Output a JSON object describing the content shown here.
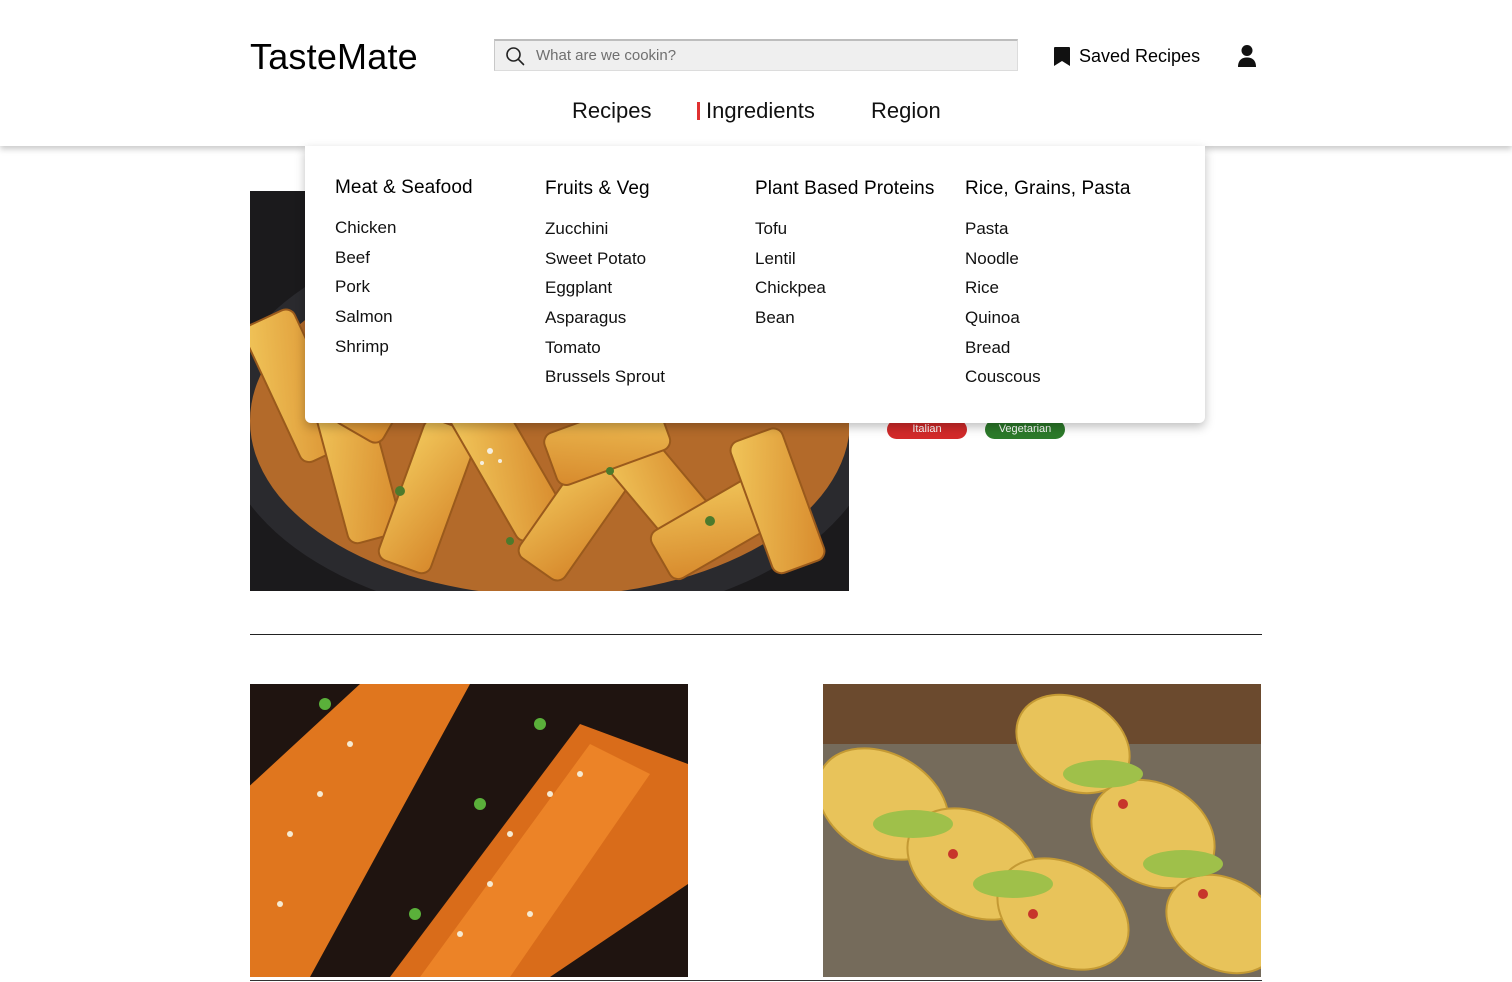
{
  "header": {
    "brand": "TasteMate",
    "search_placeholder": "What are we cookin?",
    "saved_label": "Saved Recipes"
  },
  "nav": {
    "items": [
      {
        "label": "Recipes"
      },
      {
        "label": "Ingredients",
        "active": true
      },
      {
        "label": "Region"
      }
    ]
  },
  "dropdown": {
    "columns": [
      {
        "title": "Meat & Seafood",
        "items": [
          "Chicken",
          "Beef",
          "Pork",
          "Salmon",
          "Shrimp"
        ]
      },
      {
        "title": "Fruits & Veg",
        "items": [
          "Zucchini",
          "Sweet Potato",
          "Eggplant",
          "Asparagus",
          "Tomato",
          "Brussels Sprout"
        ]
      },
      {
        "title": "Plant Based Proteins",
        "items": [
          "Tofu",
          "Lentil",
          "Chickpea",
          "Bean"
        ]
      },
      {
        "title": "Rice, Grains, Pasta",
        "items": [
          "Pasta",
          "Noodle",
          "Rice",
          "Quinoa",
          "Bread",
          "Couscous"
        ]
      }
    ]
  },
  "featured": {
    "tags": [
      "Italian",
      "Vegetarian"
    ]
  },
  "colors": {
    "accent": "#e03131",
    "tag_italian": "#d22a2a",
    "tag_vegetarian": "#2c7a2a"
  },
  "icons": {
    "search": "search-icon",
    "saved": "bookmark-icon",
    "account": "user-icon"
  }
}
